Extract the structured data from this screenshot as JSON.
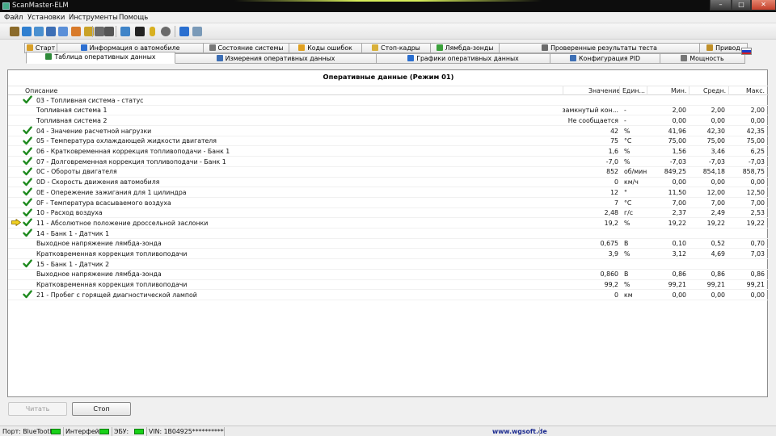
{
  "window": {
    "title": "ScanMaster-ELM"
  },
  "menu": [
    "Файл",
    "Установки",
    "Инструменты",
    "Помощь"
  ],
  "toolbar_icons": [
    "connect-icon",
    "globe-icon",
    "dashboard-icon",
    "table-icon",
    "grid-icon",
    "chart-icon",
    "fuel-icon",
    "settings-icon",
    "printer-icon",
    "chat-icon",
    "terminal-icon",
    "battery-icon",
    "tire-icon",
    "info-icon",
    "document-icon"
  ],
  "tabs_row1": [
    {
      "label": "Старт",
      "icon": "home-icon"
    },
    {
      "label": "Информация о автомобиле",
      "icon": "info-icon"
    },
    {
      "label": "Состояние системы",
      "icon": "system-icon"
    },
    {
      "label": "Коды ошибок",
      "icon": "warning-icon"
    },
    {
      "label": "Стоп-кадры",
      "icon": "snapshot-icon"
    },
    {
      "label": "Лямбда-зонды",
      "icon": "sensor-icon"
    },
    {
      "label": "Проверенные результаты теста",
      "icon": "test-icon"
    },
    {
      "label": "Привод",
      "icon": "drive-icon"
    }
  ],
  "tabs_row2": [
    {
      "label": "Таблица оперативных данных",
      "icon": "table-icon",
      "active": true
    },
    {
      "label": "Измерения оперативных данных",
      "icon": "gauge-icon"
    },
    {
      "label": "Графики оперативных данных",
      "icon": "graph-icon"
    },
    {
      "label": "Конфигурация PID",
      "icon": "config-icon"
    },
    {
      "label": "Мощность",
      "icon": "power-icon"
    }
  ],
  "grid": {
    "title": "Оперативные данные (Режим 01)",
    "columns": {
      "desc": "Описание",
      "value": "Значение",
      "unit": "Един...",
      "min": "Мин.",
      "avg": "Средн.",
      "max": "Макс."
    },
    "rows": [
      {
        "desc": "03 - Топливная система - статус",
        "value": "",
        "unit": "",
        "min": "",
        "avg": "",
        "max": "",
        "check": true,
        "indent": false
      },
      {
        "desc": "Топливная система 1",
        "value": "замкнутый кон...",
        "unit": "-",
        "min": "2,00",
        "avg": "2,00",
        "max": "2,00",
        "check": false,
        "indent": true
      },
      {
        "desc": "Топливная система 2",
        "value": "Не сообщается",
        "unit": "-",
        "min": "0,00",
        "avg": "0,00",
        "max": "0,00",
        "check": false,
        "indent": true
      },
      {
        "desc": "04 - Значение расчетной нагрузки",
        "value": "42",
        "unit": "%",
        "min": "41,96",
        "avg": "42,30",
        "max": "42,35",
        "check": true,
        "indent": false
      },
      {
        "desc": "05 - Температура охлаждающей жидкости двигателя",
        "value": "75",
        "unit": "°C",
        "min": "75,00",
        "avg": "75,00",
        "max": "75,00",
        "check": true,
        "indent": false
      },
      {
        "desc": "06 - Кратковременная коррекция топливоподачи - Банк 1",
        "value": "1,6",
        "unit": "%",
        "min": "1,56",
        "avg": "3,46",
        "max": "6,25",
        "check": true,
        "indent": false
      },
      {
        "desc": "07 - Долговременная коррекция топливоподачи - Банк 1",
        "value": "-7,0",
        "unit": "%",
        "min": "-7,03",
        "avg": "-7,03",
        "max": "-7,03",
        "check": true,
        "indent": false
      },
      {
        "desc": "0C - Обороты двигателя",
        "value": "852",
        "unit": "об/мин",
        "min": "849,25",
        "avg": "854,18",
        "max": "858,75",
        "check": true,
        "indent": false
      },
      {
        "desc": "0D - Скорость движения автомобиля",
        "value": "0",
        "unit": "км/ч",
        "min": "0,00",
        "avg": "0,00",
        "max": "0,00",
        "check": true,
        "indent": false
      },
      {
        "desc": "0E - Опережение зажигания для 1 цилиндра",
        "value": "12",
        "unit": "°",
        "min": "11,50",
        "avg": "12,00",
        "max": "12,50",
        "check": true,
        "indent": false
      },
      {
        "desc": "0F - Температура всасываемого воздуха",
        "value": "7",
        "unit": "°C",
        "min": "7,00",
        "avg": "7,00",
        "max": "7,00",
        "check": true,
        "indent": false
      },
      {
        "desc": "10 - Расход воздуха",
        "value": "2,48",
        "unit": "г/с",
        "min": "2,37",
        "avg": "2,49",
        "max": "2,53",
        "check": true,
        "indent": false
      },
      {
        "desc": "11 - Абсолютное положение дроссельной заслонки",
        "value": "19,2",
        "unit": "%",
        "min": "19,22",
        "avg": "19,22",
        "max": "19,22",
        "check": true,
        "indent": false,
        "selected": true
      },
      {
        "desc": "14 - Банк 1 - Датчик 1",
        "value": "",
        "unit": "",
        "min": "",
        "avg": "",
        "max": "",
        "check": true,
        "indent": false
      },
      {
        "desc": "Выходное напряжение лямбда-зонда",
        "value": "0,675",
        "unit": "В",
        "min": "0,10",
        "avg": "0,52",
        "max": "0,70",
        "check": false,
        "indent": true
      },
      {
        "desc": "Кратковременная коррекция топливоподачи",
        "value": "3,9",
        "unit": "%",
        "min": "3,12",
        "avg": "4,69",
        "max": "7,03",
        "check": false,
        "indent": true
      },
      {
        "desc": "15 - Банк 1 - Датчик 2",
        "value": "",
        "unit": "",
        "min": "",
        "avg": "",
        "max": "",
        "check": true,
        "indent": false
      },
      {
        "desc": "Выходное напряжение лямбда-зонда",
        "value": "0,860",
        "unit": "В",
        "min": "0,86",
        "avg": "0,86",
        "max": "0,86",
        "check": false,
        "indent": true
      },
      {
        "desc": "Кратковременная коррекция топливоподачи",
        "value": "99,2",
        "unit": "%",
        "min": "99,21",
        "avg": "99,21",
        "max": "99,21",
        "check": false,
        "indent": true
      },
      {
        "desc": "21 - Пробег с горящей диагностической лампой",
        "value": "0",
        "unit": "км",
        "min": "0,00",
        "avg": "0,00",
        "max": "0,00",
        "check": true,
        "indent": false
      }
    ]
  },
  "buttons": {
    "read": "Читать",
    "stop": "Стоп"
  },
  "status": {
    "port": "Порт: BlueTooth",
    "interface": "Интерфейс:",
    "ecu": "ЭБУ:",
    "vin": "VIN: 1B04925**********",
    "site": "www.wgsoft.de"
  },
  "colors": {
    "led_on": "#19d119",
    "check": "#1e8a1e",
    "selected_arrow": "#f0d020",
    "site_link": "#1b2a8f"
  }
}
